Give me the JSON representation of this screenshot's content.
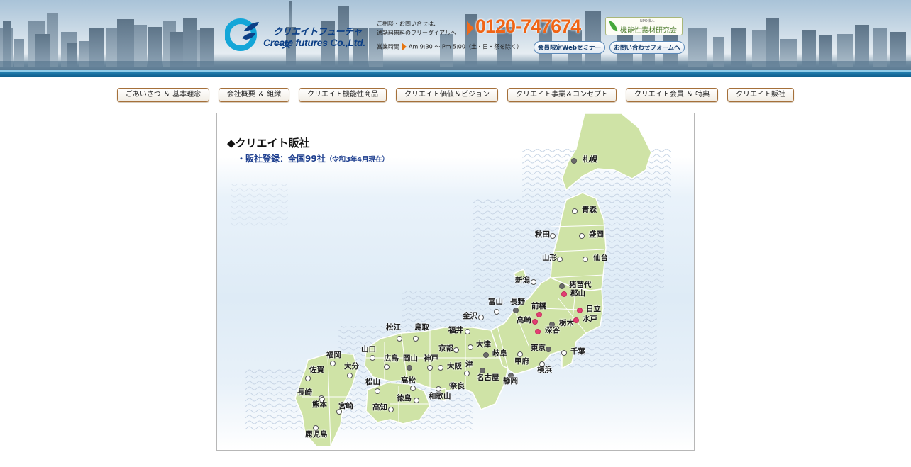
{
  "header": {
    "logo_jp": "クリエイトフューチャーズ",
    "logo_en": "Create futures Co.,Ltd.",
    "contact_line1": "ご相談・お問い合せは、",
    "contact_line2": "通話料無料のフリーダイアルへ",
    "phone": "0120-747674",
    "hours_label": "営業時間",
    "hours_value": "Am 9:30 〜 Pm 5:00（土・日・祭を除く）",
    "npo_small": "NPO法人",
    "npo_label": "機能性素材研究会",
    "seminar_button": "会員限定Webセミナー",
    "contact_button": "お問い合わせフォームへ",
    "colors": {
      "phone": "#f06415",
      "brand": "#0c3f86"
    }
  },
  "nav": {
    "items": [
      {
        "label": "ごあいさつ ＆ 基本理念"
      },
      {
        "label": "会社概要 ＆ 組織"
      },
      {
        "label": "クリエイト機能性商品"
      },
      {
        "label": "クリエイト価値＆ビジョン"
      },
      {
        "label": "クリエイト事業＆コンセプト"
      },
      {
        "label": "クリエイト会員 ＆ 特典"
      },
      {
        "label": "クリエイト販社"
      }
    ]
  },
  "map": {
    "title": "◆クリエイト販社",
    "subtitle_prefix": "・",
    "subtitle": "販社登録：全国99社",
    "subtitle_note": "（令和3年4月現在）",
    "cities": [
      {
        "name": "札幌",
        "marker": "gray"
      },
      {
        "name": "青森",
        "marker": "open"
      },
      {
        "name": "秋田",
        "marker": "open"
      },
      {
        "name": "盛岡",
        "marker": "open"
      },
      {
        "name": "山形",
        "marker": "open"
      },
      {
        "name": "仙台",
        "marker": "open"
      },
      {
        "name": "新潟",
        "marker": "open"
      },
      {
        "name": "猪苗代",
        "marker": "gray"
      },
      {
        "name": "郡山",
        "marker": "pink"
      },
      {
        "name": "富山",
        "marker": "open"
      },
      {
        "name": "長野",
        "marker": "gray"
      },
      {
        "name": "前橋",
        "marker": "pink"
      },
      {
        "name": "日立",
        "marker": "pink"
      },
      {
        "name": "金沢",
        "marker": "open"
      },
      {
        "name": "高崎",
        "marker": "pink"
      },
      {
        "name": "栃木",
        "marker": "gray"
      },
      {
        "name": "水戸",
        "marker": "pink"
      },
      {
        "name": "深谷",
        "marker": "pink"
      },
      {
        "name": "福井",
        "marker": "open"
      },
      {
        "name": "松江",
        "marker": "open"
      },
      {
        "name": "鳥取",
        "marker": "open"
      },
      {
        "name": "京都",
        "marker": "open"
      },
      {
        "name": "大津",
        "marker": "open"
      },
      {
        "name": "東京",
        "marker": "gray"
      },
      {
        "name": "千葉",
        "marker": "open"
      },
      {
        "name": "岐阜",
        "marker": "gray"
      },
      {
        "name": "山口",
        "marker": "open"
      },
      {
        "name": "福岡",
        "marker": "open"
      },
      {
        "name": "広島",
        "marker": "open"
      },
      {
        "name": "岡山",
        "marker": "gray"
      },
      {
        "name": "神戸",
        "marker": "open"
      },
      {
        "name": "甲府",
        "marker": "open"
      },
      {
        "name": "大阪",
        "marker": "open"
      },
      {
        "name": "津",
        "marker": "open"
      },
      {
        "name": "横浜",
        "marker": "open"
      },
      {
        "name": "佐賀",
        "marker": "open"
      },
      {
        "name": "大分",
        "marker": "open"
      },
      {
        "name": "名古屋",
        "marker": "gray"
      },
      {
        "name": "静岡",
        "marker": "gray"
      },
      {
        "name": "松山",
        "marker": "open"
      },
      {
        "name": "高松",
        "marker": "open"
      },
      {
        "name": "奈良",
        "marker": "open"
      },
      {
        "name": "長崎",
        "marker": "open"
      },
      {
        "name": "徳島",
        "marker": "open"
      },
      {
        "name": "和歌山",
        "marker": "open"
      },
      {
        "name": "熊本",
        "marker": "open"
      },
      {
        "name": "宮崎",
        "marker": "open"
      },
      {
        "name": "高知",
        "marker": "open"
      },
      {
        "name": "鹿児島",
        "marker": "open"
      }
    ],
    "colors": {
      "land": "#cfe3a6",
      "land_stroke": "#ffffff",
      "pink_marker": "#e33e73",
      "gray_marker": "#6b6b6b"
    }
  }
}
